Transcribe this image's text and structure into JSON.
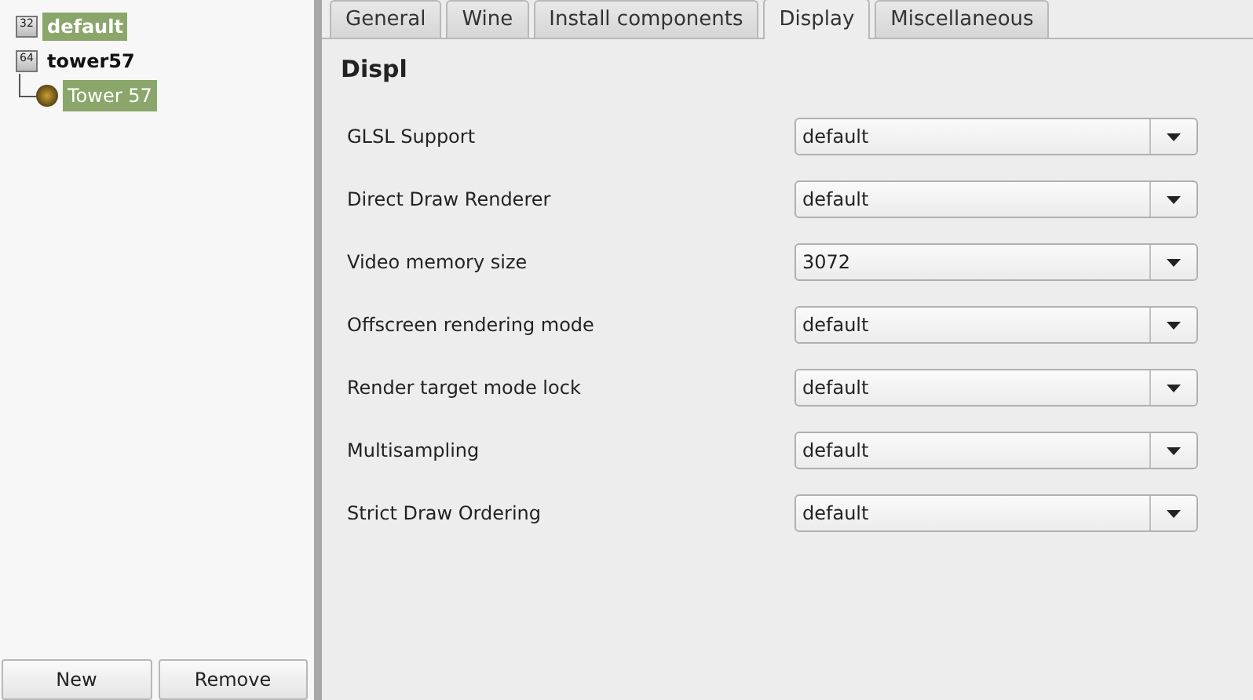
{
  "tree": [
    {
      "label": "default",
      "badge": "32",
      "selected": true
    },
    {
      "label": "tower57",
      "badge": "64",
      "selected": false,
      "children": [
        {
          "label": "Tower 57",
          "selected": true
        }
      ]
    }
  ],
  "buttons": [
    "New",
    "Remove"
  ],
  "tabs": [
    {
      "label": "General",
      "selected": false
    },
    {
      "label": "Wine",
      "selected": false
    },
    {
      "label": "Install components",
      "selected": false
    },
    {
      "label": "Display",
      "selected": true
    },
    {
      "label": "Miscellaneous",
      "selected": false
    }
  ],
  "heading": "Displ",
  "settings": [
    {
      "label": "GLSL Support",
      "value": "default"
    },
    {
      "label": "Direct Draw Renderer",
      "value": "default"
    },
    {
      "label": "Video memory size",
      "value": "3072"
    },
    {
      "label": "Offscreen rendering mode",
      "value": "default"
    },
    {
      "label": "Render target mode lock",
      "value": "default"
    },
    {
      "label": "Multisampling",
      "value": "default"
    },
    {
      "label": "Strict Draw Ordering",
      "value": "default"
    }
  ]
}
